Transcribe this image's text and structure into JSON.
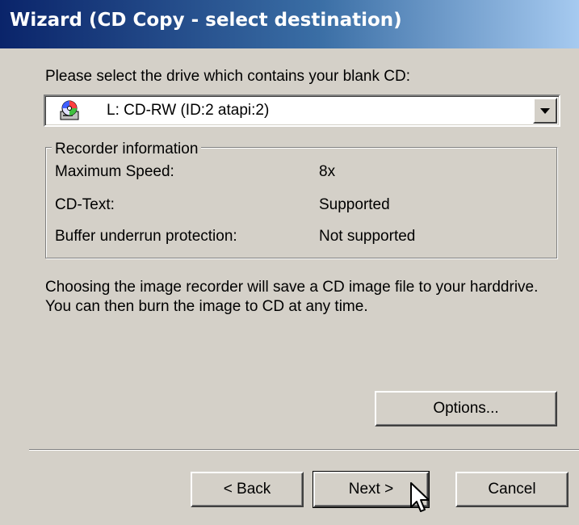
{
  "window": {
    "title": "Wizard (CD Copy - select destination)"
  },
  "prompt": "Please select the drive which contains your blank CD:",
  "drive_select": {
    "selected": "L: CD-RW (ID:2 atapi:2)",
    "icon": "cd-drive-icon"
  },
  "recorder_info": {
    "legend": "Recorder information",
    "rows": [
      {
        "label": "Maximum Speed:",
        "value": "8x"
      },
      {
        "label": "CD-Text:",
        "value": "Supported"
      },
      {
        "label": "Buffer underrun protection:",
        "value": "Not supported"
      }
    ]
  },
  "description": "Choosing the image recorder will save a CD image file to your harddrive. You can then burn the image to CD at any time.",
  "buttons": {
    "options": "Options...",
    "back": "< Back",
    "next": "Next >",
    "cancel": "Cancel"
  },
  "colors": {
    "title_gradient_start": "#0a246a",
    "title_gradient_end": "#a6caf0",
    "dialog_background": "#d4d0c8"
  }
}
